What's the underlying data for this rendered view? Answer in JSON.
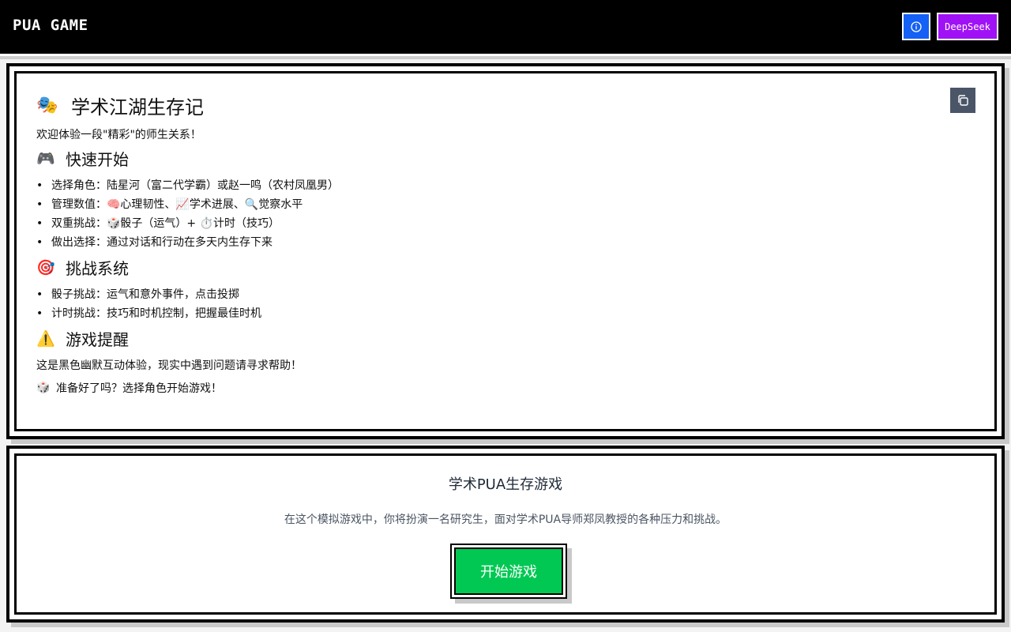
{
  "header": {
    "brand": "PUA GAME",
    "deepseek_label": "DeepSeek",
    "colors": {
      "bar": "#000000",
      "info": "#1560f5",
      "deepseek": "#a012f5"
    }
  },
  "intro": {
    "title_emoji": "🎭",
    "title": "学术江湖生存记",
    "welcome": "欢迎体验一段\"精彩\"的师生关系！",
    "quick_start": {
      "emoji": "🎮",
      "title": "快速开始",
      "items": [
        "选择角色：陆星河（富二代学霸）或赵一鸣（农村凤凰男）",
        "管理数值：🧠心理韧性、📈学术进展、🔍觉察水平",
        "双重挑战：🎲骰子（运气）+ ⏱️计时（技巧）",
        "做出选择：通过对话和行动在多天内生存下来"
      ]
    },
    "challenge": {
      "emoji": "🎯",
      "title": "挑战系统",
      "items": [
        "骰子挑战：运气和意外事件，点击投掷",
        "计时挑战：技巧和时机控制，把握最佳时机"
      ]
    },
    "tips": {
      "emoji": "⚠️",
      "title": "游戏提醒",
      "text": "这是黑色幽默互动体验，现实中遇到问题请寻求帮助！"
    },
    "ready_emoji": "🎲",
    "ready": "准备好了吗？选择角色开始游戏！"
  },
  "start_card": {
    "title": "学术PUA生存游戏",
    "description": "在这个模拟游戏中，你将扮演一名研究生，面对学术PUA导师郑凤教授的各种压力和挑战。",
    "start_label": "开始游戏",
    "colors": {
      "start": "#00c853"
    }
  },
  "icons": {
    "info": "info-icon",
    "copy": "copy-icon",
    "bullet": "•"
  }
}
